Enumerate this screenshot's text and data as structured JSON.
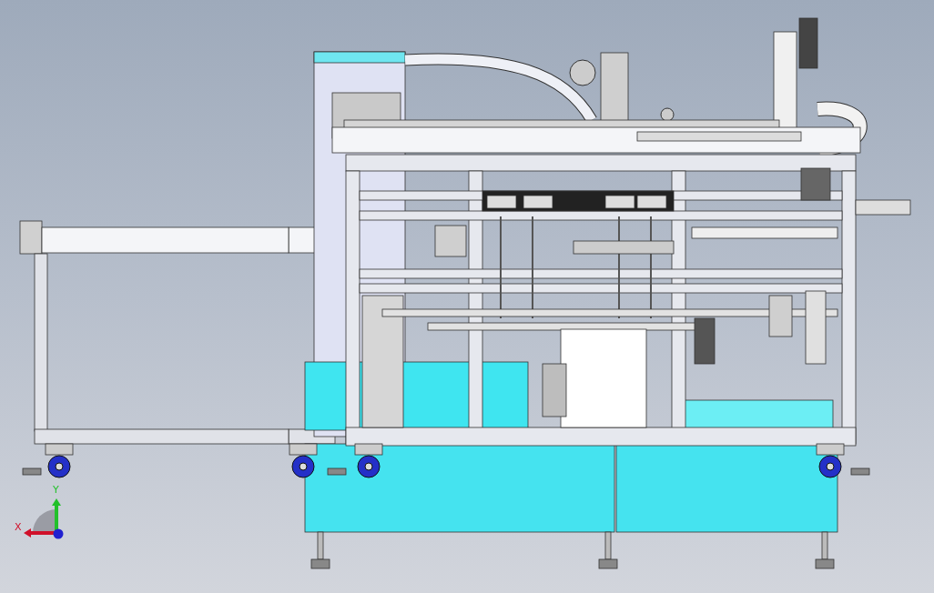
{
  "viewport": {
    "triad": {
      "axes": [
        {
          "kind": "x",
          "label": "X",
          "color": "#d0102a"
        },
        {
          "kind": "y",
          "label": "Y",
          "color": "#22c02a"
        }
      ]
    }
  }
}
